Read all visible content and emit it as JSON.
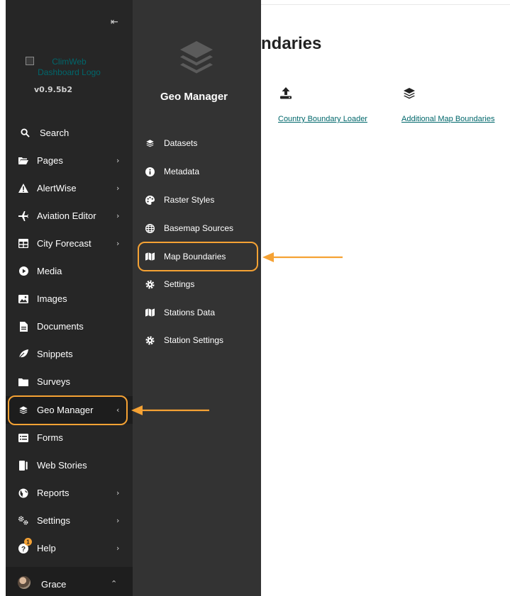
{
  "sidebar": {
    "collapse_glyph": "⇤",
    "logo_alt": "ClimWeb Dashboard Logo",
    "version": "v0.9.5b2",
    "search_label": "Search",
    "items": [
      {
        "label": "Pages",
        "icon": "folder-open-icon",
        "has_children": true
      },
      {
        "label": "AlertWise",
        "icon": "warning-icon",
        "has_children": true
      },
      {
        "label": "Aviation Editor",
        "icon": "plane-icon",
        "has_children": true
      },
      {
        "label": "City Forecast",
        "icon": "table-icon",
        "has_children": true
      },
      {
        "label": "Media",
        "icon": "play-circle-icon",
        "has_children": false
      },
      {
        "label": "Images",
        "icon": "image-icon",
        "has_children": false
      },
      {
        "label": "Documents",
        "icon": "document-icon",
        "has_children": false
      },
      {
        "label": "Snippets",
        "icon": "leaf-icon",
        "has_children": false
      },
      {
        "label": "Surveys",
        "icon": "folder-icon",
        "has_children": false
      },
      {
        "label": "Geo Manager",
        "icon": "layers-icon",
        "has_children": true,
        "expanded": true
      },
      {
        "label": "Forms",
        "icon": "list-icon",
        "has_children": false
      },
      {
        "label": "Web Stories",
        "icon": "book-icon",
        "has_children": false
      },
      {
        "label": "Reports",
        "icon": "globe-icon",
        "has_children": true
      },
      {
        "label": "Settings",
        "icon": "cogs-icon",
        "has_children": true
      },
      {
        "label": "Help",
        "icon": "help-icon",
        "has_children": true,
        "badge": "1"
      }
    ],
    "user": {
      "name": "Grace"
    }
  },
  "submenu": {
    "title": "Geo Manager",
    "items": [
      {
        "label": "Datasets",
        "icon": "layers-icon"
      },
      {
        "label": "Metadata",
        "icon": "info-circle-icon"
      },
      {
        "label": "Raster Styles",
        "icon": "palette-icon"
      },
      {
        "label": "Basemap Sources",
        "icon": "globe-icon"
      },
      {
        "label": "Map Boundaries",
        "icon": "map-icon",
        "active": true
      },
      {
        "label": "Settings",
        "icon": "cog-icon"
      },
      {
        "label": "Stations Data",
        "icon": "map-icon"
      },
      {
        "label": "Station Settings",
        "icon": "cog-icon"
      }
    ]
  },
  "main": {
    "title_visible": "ndaries",
    "links": [
      {
        "label": "Country Boundary Loader",
        "icon": "upload-icon"
      },
      {
        "label": "Additional Map Boundaries",
        "icon": "layers-icon"
      }
    ]
  },
  "colors": {
    "sidebar_bg": "#262626",
    "submenu_bg": "#333333",
    "link": "#00676b",
    "annotation": "#f5a234"
  }
}
